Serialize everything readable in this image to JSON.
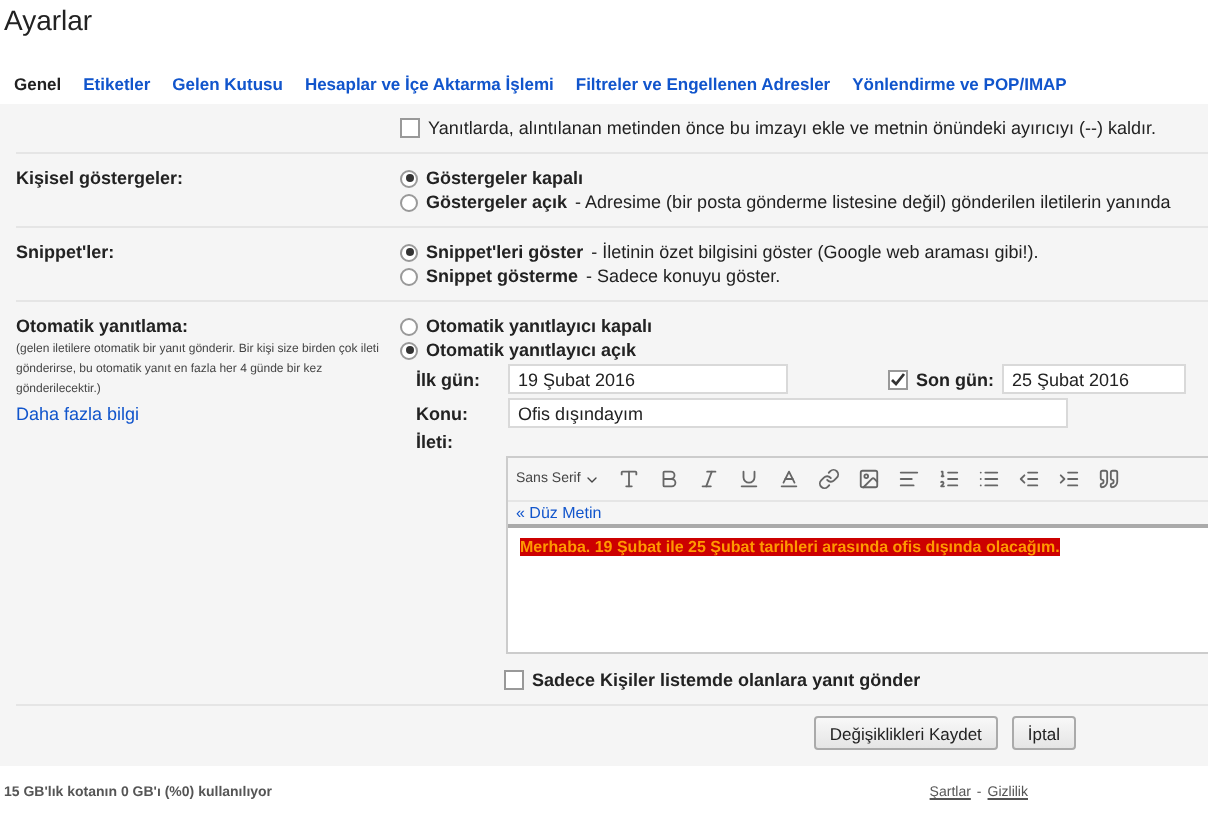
{
  "title": "Ayarlar",
  "tabs": [
    {
      "label": "Genel",
      "selected": true
    },
    {
      "label": "Etiketler",
      "selected": false
    },
    {
      "label": "Gelen Kutusu",
      "selected": false
    },
    {
      "label": "Hesaplar ve İçe Aktarma İşlemi",
      "selected": false
    },
    {
      "label": "Filtreler ve Engellenen Adresler",
      "selected": false
    },
    {
      "label": "Yönlendirme ve POP/IMAP",
      "selected": false
    }
  ],
  "signature_option": {
    "label": "Yanıtlarda, alıntılanan metinden önce bu imzayı ekle ve metnin önündeki ayırıcıyı (--) kaldır.",
    "checked": false
  },
  "sections": [
    {
      "label": "Kişisel göstergeler:",
      "options": [
        {
          "label": "Göstergeler kapalı",
          "selected": true
        },
        {
          "label": "Göstergeler açık",
          "description": "- Adresime (bir posta gönderme listesine değil) gönderilen iletilerin yanında",
          "selected": false
        }
      ]
    },
    {
      "label": "Snippet'ler:",
      "options": [
        {
          "label": "Snippet'leri göster",
          "description": "- İletinin özet bilgisini göster (Google web araması gibi!).",
          "selected": true
        },
        {
          "label": "Snippet gösterme",
          "description": "- Sadece konuyu göster.",
          "selected": false
        }
      ]
    }
  ],
  "auto_reply": {
    "label": "Otomatik yanıtlama:",
    "note": "(gelen iletilere otomatik bir yanıt gönderir. Bir kişi size birden çok ileti gönderirse, bu otomatik yanıt en fazla her 4 günde bir kez gönderilecektir.)",
    "link": "Daha fazla bilgi",
    "options": [
      {
        "label": "Otomatik yanıtlayıcı kapalı",
        "selected": false
      },
      {
        "label": "Otomatik yanıtlayıcı açık",
        "selected": true
      }
    ],
    "start_date": {
      "label": "İlk gün:",
      "value": "19 Şubat 2016"
    },
    "end_date": {
      "label": "Son gün:",
      "value": "25 Şubat 2016",
      "checked": true
    },
    "subject": {
      "label": "Konu:",
      "value": "Ofis dışındayım"
    },
    "message": {
      "label": "İleti:",
      "font": "Sans Serif",
      "plain_text_link": "« Düz Metin",
      "body": "Merhaba. 19 Şubat ile 25 Şubat tarihleri arasında ofis dışında olacağım."
    },
    "contacts_only": {
      "label": "Sadece Kişiler listemde olanlara yanıt gönder",
      "checked": false
    }
  },
  "buttons": [
    {
      "label": "Değişiklikleri Kaydet"
    },
    {
      "label": "İptal"
    }
  ],
  "footer": {
    "quota": "15 GB'lık kotanın 0 GB'ı (%0) kullanılıyor",
    "links": [
      "Şartlar",
      "Gizlilik"
    ],
    "separator": "-"
  }
}
